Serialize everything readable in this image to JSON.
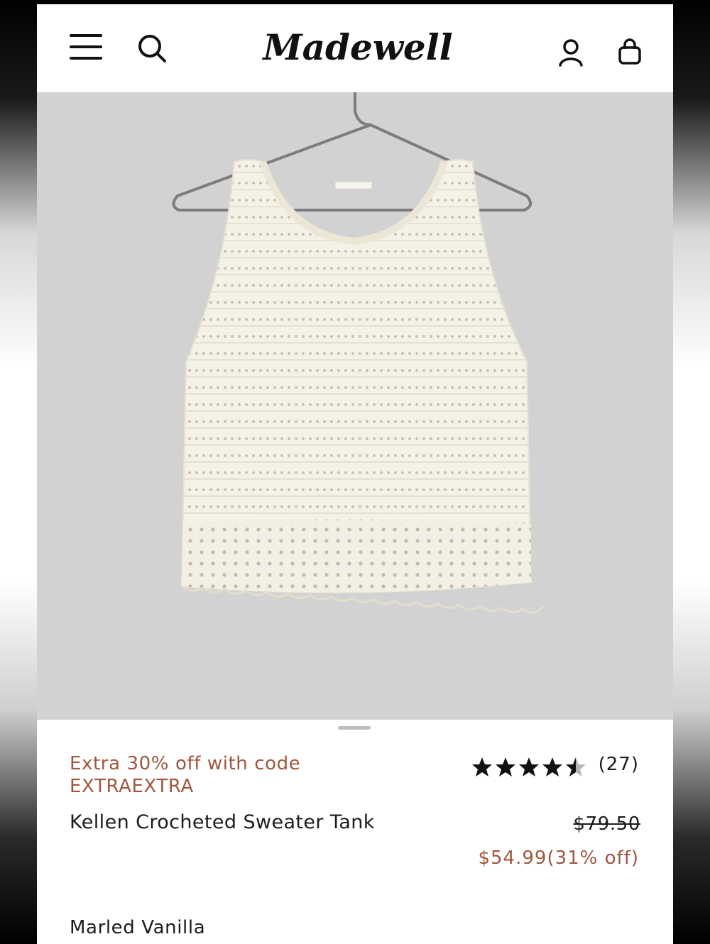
{
  "header": {
    "brand": "Madewell",
    "icons": [
      "menu-icon",
      "search-icon",
      "account-icon",
      "shopping-bag-icon"
    ]
  },
  "product": {
    "image_alt": "white crocheted sleeveless sweater tank on hanger",
    "promo_line1": "Extra 30% off with code",
    "promo_line2": "EXTRAEXTRA",
    "name": "Kellen Crocheted Sweater Tank",
    "rating": 4.5,
    "review_count": "(27)",
    "original_price": "$79.50",
    "sale_price": "$54.99",
    "discount": "(31% off)",
    "color": "Marled Vanilla"
  },
  "colors": {
    "accent": "#a0573e",
    "text": "#1c1c1c",
    "hero_bg": "#d2d2d2"
  }
}
